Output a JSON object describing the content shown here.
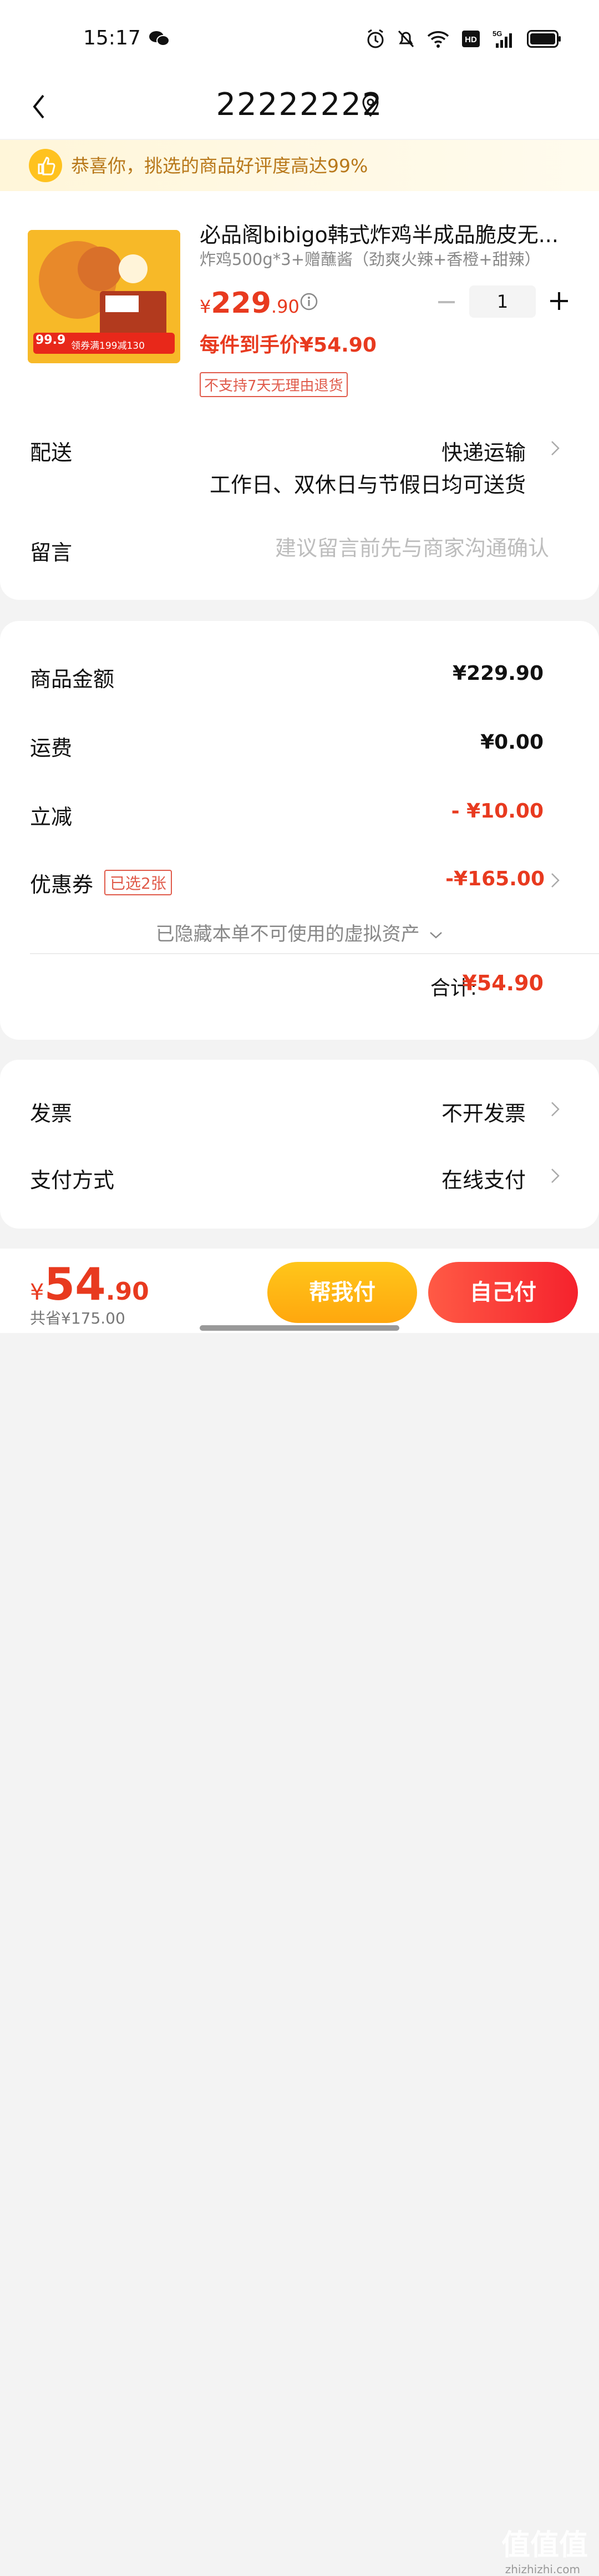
{
  "status_bar": {
    "time": "15:17"
  },
  "header": {
    "title": "22222222"
  },
  "banner": {
    "text": "恭喜你，挑选的商品好评度高达99%"
  },
  "product": {
    "title": "必品阁bibigo韩式炸鸡半成品脆皮无...",
    "spec": "炸鸡500g*3+赠蘸酱（劲爽火辣+香橙+甜辣）",
    "price_currency": "¥",
    "price_int": "229",
    "price_dec": ".90",
    "quantity": "1",
    "each_price": "每件到手价¥54.90",
    "no_return_tag": "不支持7天无理由退货",
    "image_badge_price": "99.9",
    "image_badge_coupon": "领券满199减130"
  },
  "delivery": {
    "label": "配送",
    "method": "快递运输",
    "note": "工作日、双休日与节假日均可送货"
  },
  "message": {
    "label": "留言",
    "placeholder": "建议留言前先与商家沟通确认"
  },
  "summary": {
    "goods_label": "商品金额",
    "goods_value": "¥229.90",
    "shipping_label": "运费",
    "shipping_value": "¥0.00",
    "discount_label": "立减",
    "discount_value": "- ¥10.00",
    "coupon_label": "优惠券",
    "coupon_tag": "已选2张",
    "coupon_value": "-¥165.00",
    "hidden_assets": "已隐藏本单不可使用的虚拟资产",
    "total_label": "合计:",
    "total_value": "¥54.90"
  },
  "options": {
    "invoice_label": "发票",
    "invoice_value": "不开发票",
    "payment_label": "支付方式",
    "payment_value": "在线支付"
  },
  "bottom": {
    "currency": "¥",
    "price_int": "54",
    "price_dec": ".90",
    "saved": "共省¥175.00",
    "help_pay": "帮我付",
    "self_pay": "自己付",
    "watermark": "值值值",
    "watermark_sub": "zhizhizhi.com"
  },
  "colors": {
    "accent_red": "#e83a1f",
    "help_button": "#ffb414",
    "banner_text": "#b8781a"
  }
}
